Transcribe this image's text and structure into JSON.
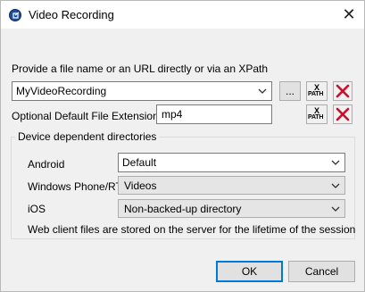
{
  "window": {
    "title": "Video Recording",
    "close_glyph": "✕"
  },
  "prompt_label": "Provide a file name or an URL directly or via an XPath",
  "file": {
    "value": "MyVideoRecording",
    "browse_label": "..."
  },
  "xpath_button": {
    "x": "X",
    "path": "PATH"
  },
  "extension": {
    "label": "Optional Default File Extension",
    "value": "mp4"
  },
  "devices": {
    "group_label": "Device dependent directories",
    "android": {
      "label": "Android",
      "value": "Default"
    },
    "windows_phone": {
      "label": "Windows Phone/RT",
      "value": "Videos"
    },
    "ios": {
      "label": "iOS",
      "value": "Non-backed-up directory"
    },
    "note": "Web client files are stored on the server for the lifetime of the session"
  },
  "buttons": {
    "ok": "OK",
    "cancel": "Cancel"
  },
  "colors": {
    "delete_red": "#c8102e",
    "app_icon": "#1d4f9a",
    "focus_blue": "#0078d7"
  },
  "icons": [
    "app-icon",
    "close-icon",
    "chevron-down-icon",
    "xpath-icon",
    "delete-icon"
  ]
}
